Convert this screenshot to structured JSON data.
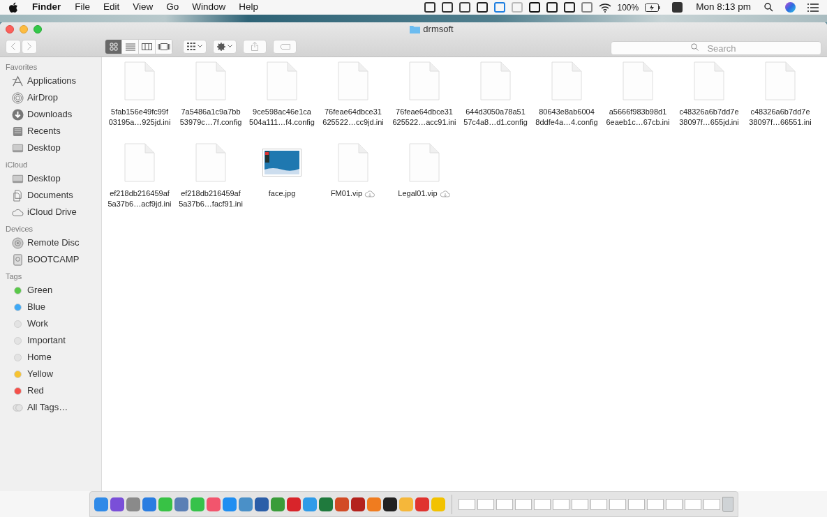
{
  "menu_bar": {
    "app_name": "Finder",
    "menus": [
      "File",
      "Edit",
      "View",
      "Go",
      "Window",
      "Help"
    ],
    "battery": "100%",
    "clock": "Mon 8:13 pm"
  },
  "window": {
    "title": "drmsoft"
  },
  "toolbar": {
    "view_modes": [
      {
        "kind": "icons",
        "selected": true
      },
      {
        "kind": "list",
        "selected": false
      },
      {
        "kind": "columns",
        "selected": false
      },
      {
        "kind": "gallery",
        "selected": false
      }
    ],
    "search": {
      "placeholder": "Search"
    }
  },
  "sidebar": {
    "sections": [
      {
        "title": "Favorites",
        "items": [
          {
            "label": "Applications",
            "kind": "applications"
          },
          {
            "label": "AirDrop",
            "kind": "airdrop"
          },
          {
            "label": "Downloads",
            "kind": "downloads"
          },
          {
            "label": "Recents",
            "kind": "recents"
          },
          {
            "label": "Desktop",
            "kind": "desktop"
          }
        ]
      },
      {
        "title": "iCloud",
        "items": [
          {
            "label": "Desktop",
            "kind": "desktop"
          },
          {
            "label": "Documents",
            "kind": "documents"
          },
          {
            "label": "iCloud Drive",
            "kind": "cloud"
          }
        ]
      },
      {
        "title": "Devices",
        "items": [
          {
            "label": "Remote Disc",
            "kind": "disc"
          },
          {
            "label": "BOOTCAMP",
            "kind": "drive"
          }
        ]
      },
      {
        "title": "Tags",
        "items": [
          {
            "label": "Green",
            "kind": "tag",
            "color": "#5ac84a"
          },
          {
            "label": "Blue",
            "kind": "tag",
            "color": "#3fa9f5"
          },
          {
            "label": "Work",
            "kind": "tag",
            "color": "#e3e3e3"
          },
          {
            "label": "Important",
            "kind": "tag",
            "color": "#e3e3e3"
          },
          {
            "label": "Home",
            "kind": "tag",
            "color": "#e3e3e3"
          },
          {
            "label": "Yellow",
            "kind": "tag",
            "color": "#f7c331"
          },
          {
            "label": "Red",
            "kind": "tag",
            "color": "#f4504a"
          },
          {
            "label": "All Tags…",
            "kind": "all_tags"
          }
        ]
      }
    ]
  },
  "files": [
    {
      "lines": [
        "5fab156e49fc99f",
        "03195a…925jd.ini"
      ],
      "kind": "document",
      "in_cloud": false
    },
    {
      "lines": [
        "7a5486a1c9a7bb",
        "53979c…7f.config"
      ],
      "kind": "document",
      "in_cloud": false
    },
    {
      "lines": [
        "9ce598ac46e1ca",
        "504a111…f4.config"
      ],
      "kind": "document",
      "in_cloud": false
    },
    {
      "lines": [
        "76feae64dbce31",
        "625522…cc9jd.ini"
      ],
      "kind": "document",
      "in_cloud": false
    },
    {
      "lines": [
        "76feae64dbce31",
        "625522…acc91.ini"
      ],
      "kind": "document",
      "in_cloud": false
    },
    {
      "lines": [
        "644d3050a78a51",
        "57c4a8…d1.config"
      ],
      "kind": "document",
      "in_cloud": false
    },
    {
      "lines": [
        "80643e8ab6004",
        "8ddfe4a…4.config"
      ],
      "kind": "document",
      "in_cloud": false
    },
    {
      "lines": [
        "a5666f983b98d1",
        "6eaeb1c…67cb.ini"
      ],
      "kind": "document",
      "in_cloud": false
    },
    {
      "lines": [
        "c48326a6b7dd7e",
        "38097f…655jd.ini"
      ],
      "kind": "document",
      "in_cloud": false
    },
    {
      "lines": [
        "c48326a6b7dd7e",
        "38097f…66551.ini"
      ],
      "kind": "document",
      "in_cloud": false
    },
    {
      "lines": [
        "ef218db216459af",
        "5a37b6…acf9jd.ini"
      ],
      "kind": "document",
      "in_cloud": false
    },
    {
      "lines": [
        "ef218db216459af",
        "5a37b6…facf91.ini"
      ],
      "kind": "document",
      "in_cloud": false
    },
    {
      "lines": [
        "face.jpg"
      ],
      "kind": "image",
      "in_cloud": false
    },
    {
      "lines": [
        "FM01.vip"
      ],
      "kind": "document",
      "in_cloud": true
    },
    {
      "lines": [
        "Legal01.vip"
      ],
      "kind": "document",
      "in_cloud": true
    }
  ]
}
